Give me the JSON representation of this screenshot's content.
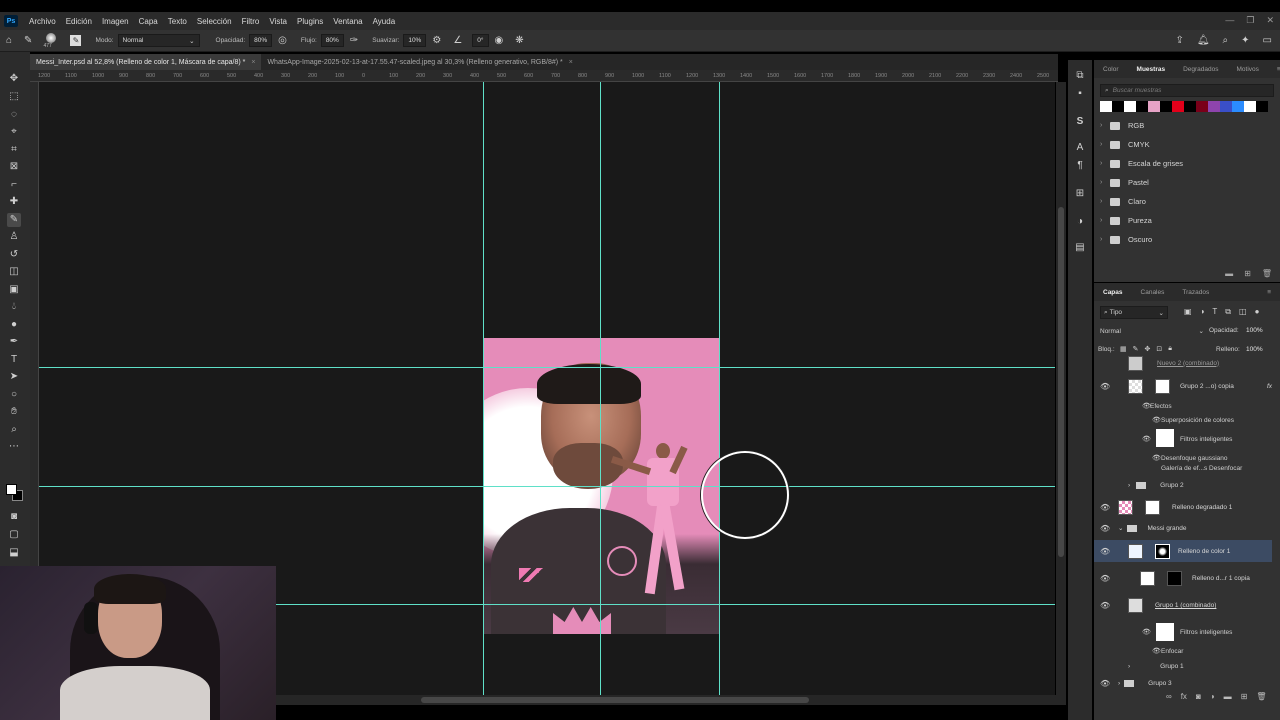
{
  "menu": {
    "logo": "Ps",
    "items": [
      "Archivo",
      "Edición",
      "Imagen",
      "Capa",
      "Texto",
      "Selección",
      "Filtro",
      "Vista",
      "Plugins",
      "Ventana",
      "Ayuda"
    ],
    "window_controls": [
      "—",
      "❐",
      "✕"
    ]
  },
  "options": {
    "brush_size": "477",
    "mode_label": "Modo:",
    "mode_value": "Normal",
    "opacity_label": "Opacidad:",
    "opacity_value": "80%",
    "flow_label": "Flujo:",
    "flow_value": "80%",
    "smoothing_label": "Suavizar:",
    "smoothing_value": "10%",
    "angle_value": "0°"
  },
  "tabs": [
    {
      "label": "Messi_Inter.psd al 52,8% (Relleno de color 1, Máscara de capa/8) *",
      "active": true
    },
    {
      "label": "WhatsApp-Image-2025-02-13-at-17.55.47-scaled.jpeg al 30,3% (Relleno generativo, RGB/8#) *",
      "active": false
    }
  ],
  "ruler": {
    "ticks": [
      "1200",
      "1100",
      "1000",
      "900",
      "800",
      "700",
      "600",
      "500",
      "400",
      "300",
      "200",
      "100",
      "0",
      "100",
      "200",
      "300",
      "400",
      "500",
      "600",
      "700",
      "800",
      "900",
      "1000",
      "1100",
      "1200",
      "1300",
      "1400",
      "1500",
      "1600",
      "1700",
      "1800",
      "1900",
      "2000",
      "2100",
      "2200",
      "2300",
      "2400",
      "2500"
    ]
  },
  "swatches_panel": {
    "tabs": [
      "Color",
      "Muestras",
      "Degradados",
      "Motivos"
    ],
    "active_tab": "Muestras",
    "search_placeholder": "Buscar muestras",
    "colors": [
      "#ffffff",
      "#000000",
      "#ffffff",
      "#000000",
      "#e7a3c6",
      "#000000",
      "#e2001a",
      "#000000",
      "#7a0019",
      "#8e44ad",
      "#3a4fc8",
      "#2b8cff",
      "#ffffff",
      "#000000"
    ],
    "folders": [
      "RGB",
      "CMYK",
      "Escala de grises",
      "Pastel",
      "Claro",
      "Pureza",
      "Oscuro"
    ]
  },
  "layers_panel": {
    "tabs": [
      "Capas",
      "Canales",
      "Trazados"
    ],
    "active_tab": "Capas",
    "filter": "Tipo",
    "blend_mode": "Normal",
    "opacity_label": "Opacidad:",
    "opacity_value": "100%",
    "lock_label": "Bloq.:",
    "fill_label": "Relleno:",
    "fill_value": "100%",
    "rows": {
      "r0": "Nuevo 2 (combinado)",
      "r1": "Grupo 2 ...o) copia",
      "r1_effects": "Efectos",
      "r1_eff1": "Superposición de colores",
      "r1_smart": "Filtros inteligentes",
      "r1_blur": "Desenfoque gaussiano",
      "r1_gallery": "Galería de ef...s Desenfocar",
      "r2": "Grupo 2",
      "r3": "Relleno degradado 1",
      "r4": "Messi grande",
      "r5": "Relleno de color 1",
      "r6": "Relleno d...r 1 copia",
      "r7": "Grupo 1 (combinado)",
      "r7_smart": "Filtros inteligentes",
      "r7_sharpen": "Enfocar",
      "r8": "Grupo 1",
      "r9": "Grupo 3"
    }
  }
}
